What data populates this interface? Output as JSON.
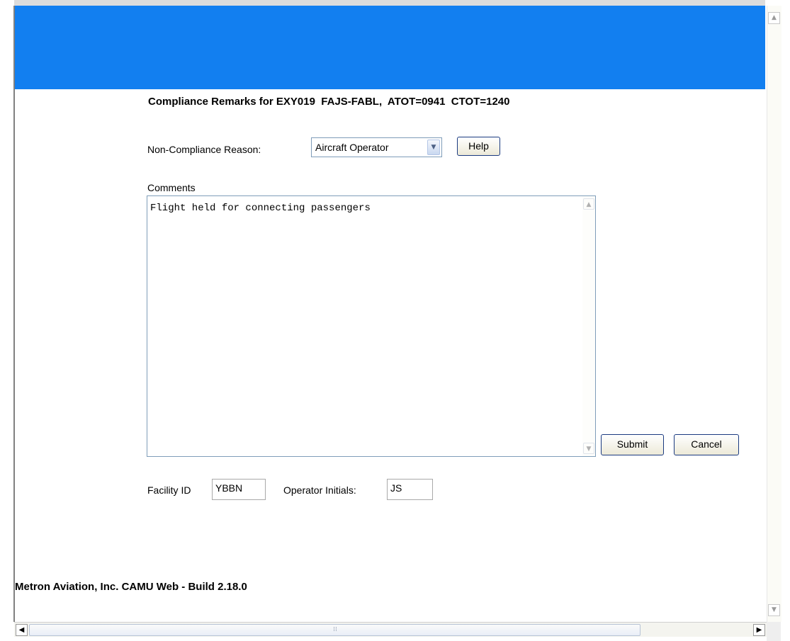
{
  "header": {
    "band_color": "#127ff0"
  },
  "form": {
    "title": "Compliance Remarks for EXY019  FAJS-FABL,  ATOT=0941  CTOT=1240",
    "reason_label": "Non-Compliance Reason:",
    "reason_value": "Aircraft Operator",
    "help_label": "Help",
    "comments_label": "Comments",
    "comments_value": "Flight held for connecting passengers",
    "submit_label": "Submit",
    "cancel_label": "Cancel",
    "facility_label": "Facility ID",
    "facility_value": "YBBN",
    "initials_label": "Operator Initials:",
    "initials_value": "JS"
  },
  "footer": {
    "text": "Metron Aviation, Inc. CAMU Web - Build 2.18.0"
  },
  "icons": {
    "dropdown": "chevron-down-icon",
    "scroll_up": "scroll-up-icon",
    "scroll_down": "scroll-down-icon",
    "scroll_left": "scroll-left-icon",
    "scroll_right": "scroll-right-icon"
  }
}
